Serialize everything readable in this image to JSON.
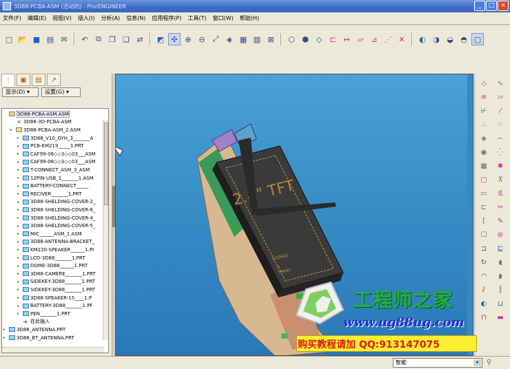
{
  "window": {
    "title": "3D88-PCBA-ASM (活动的) - Pro/ENGINEER",
    "minimize": "_",
    "maximize": "□",
    "close": "×"
  },
  "menu": [
    "文件(F)",
    "编辑(E)",
    "视图(V)",
    "插入(I)",
    "分析(A)",
    "信息(N)",
    "应用程序(P)",
    "工具(T)",
    "窗口(W)",
    "帮助(H)"
  ],
  "panel": {
    "show_label": "显示(D) ▾",
    "settings_label": "设置(G) ▾"
  },
  "tree": [
    {
      "label": "3D88-PCBA-ASM.ASM",
      "level": 0,
      "icon": "root",
      "exp": ""
    },
    {
      "label": "3D88-3D-PCBA-ASM",
      "level": 1,
      "icon": "csys",
      "exp": ""
    },
    {
      "label": "3D88-PCBA-ASM_2.ASM",
      "level": 1,
      "icon": "asm",
      "exp": "▸"
    },
    {
      "label": "3D88_V10_GYH_3_______A",
      "level": 2,
      "icon": "part",
      "exp": "▸"
    },
    {
      "label": "PCB-KM219_____1.PRT",
      "level": 2,
      "icon": "part",
      "exp": "▸"
    },
    {
      "label": "CAF99-06◇◇3◇◇03___ASM",
      "level": 2,
      "icon": "part",
      "exp": "▸"
    },
    {
      "label": "CAF99-06◇◇3◇◇03___ASM",
      "level": 2,
      "icon": "part",
      "exp": "▸"
    },
    {
      "label": "T-CONNECT_ASM_3_ASM",
      "level": 2,
      "icon": "part",
      "exp": "▸"
    },
    {
      "label": "12PIN-USB_1_______1.ASM",
      "level": 2,
      "icon": "part",
      "exp": "▸"
    },
    {
      "label": "BATTERY-CONNECT_____",
      "level": 2,
      "icon": "part",
      "exp": "▸"
    },
    {
      "label": "RECIVER_______1.PRT",
      "level": 2,
      "icon": "part",
      "exp": "▸"
    },
    {
      "label": "3D88-SHELDING-COVER-2_",
      "level": 2,
      "icon": "part",
      "exp": "▸"
    },
    {
      "label": "3D88-SHELDING-COVER-6_",
      "level": 2,
      "icon": "part",
      "exp": "▸"
    },
    {
      "label": "3D88-SHELDING-COVER-4_",
      "level": 2,
      "icon": "part",
      "exp": "▸"
    },
    {
      "label": "3D88-SHELDING-COVER-5_",
      "level": 2,
      "icon": "part",
      "exp": "▸"
    },
    {
      "label": "MIC______ASM_1.ASM",
      "level": 2,
      "icon": "part",
      "exp": "▸"
    },
    {
      "label": "3D88-ANTENNA-BRACKET_",
      "level": 2,
      "icon": "part",
      "exp": "▸"
    },
    {
      "label": "KM220-SPEAKER______1.PI",
      "level": 2,
      "icon": "part",
      "exp": "▸"
    },
    {
      "label": "LCD-3D88_______1.PRT",
      "level": 2,
      "icon": "part",
      "exp": "▸"
    },
    {
      "label": "DOME-3D88______1.PRT",
      "level": 2,
      "icon": "part",
      "exp": "▸"
    },
    {
      "label": "3D88-CAMERE_______1.PRT",
      "level": 2,
      "icon": "part",
      "exp": "▸"
    },
    {
      "label": "SIDEKEY-3D88_______1.PRT",
      "level": 2,
      "icon": "part",
      "exp": "▸"
    },
    {
      "label": "SIDEKEY-3D88_______1.PRT",
      "level": 2,
      "icon": "part",
      "exp": "▸"
    },
    {
      "label": "3D88-SPEAKER-15____1.P",
      "level": 2,
      "icon": "part",
      "exp": "▸"
    },
    {
      "label": "BATTERY-3D88_______1.PF",
      "level": 2,
      "icon": "part",
      "exp": "▸"
    },
    {
      "label": "PEN_______1.PRT",
      "level": 2,
      "icon": "part",
      "exp": "▸"
    },
    {
      "label": "在此插入",
      "level": 2,
      "icon": "ins",
      "exp": ""
    },
    {
      "label": "3D88_ANTENNA.PRT",
      "level": 0,
      "icon": "part",
      "exp": "▸"
    },
    {
      "label": "3D88_BT_ANTENNA.PRT",
      "level": 0,
      "icon": "part",
      "exp": "▸"
    }
  ],
  "viewport": {
    "screen_text": "2.4\" TFT",
    "pcb_label": "LCD441",
    "pcb_label2": "TPA41"
  },
  "status": {
    "filter_value": "智能",
    "filter_arrow": "▾"
  },
  "watermark": {
    "logo_text": "工程师之家",
    "url": "www.ug88ug.com",
    "banner": "购买教程请加 QQ:913147075"
  }
}
